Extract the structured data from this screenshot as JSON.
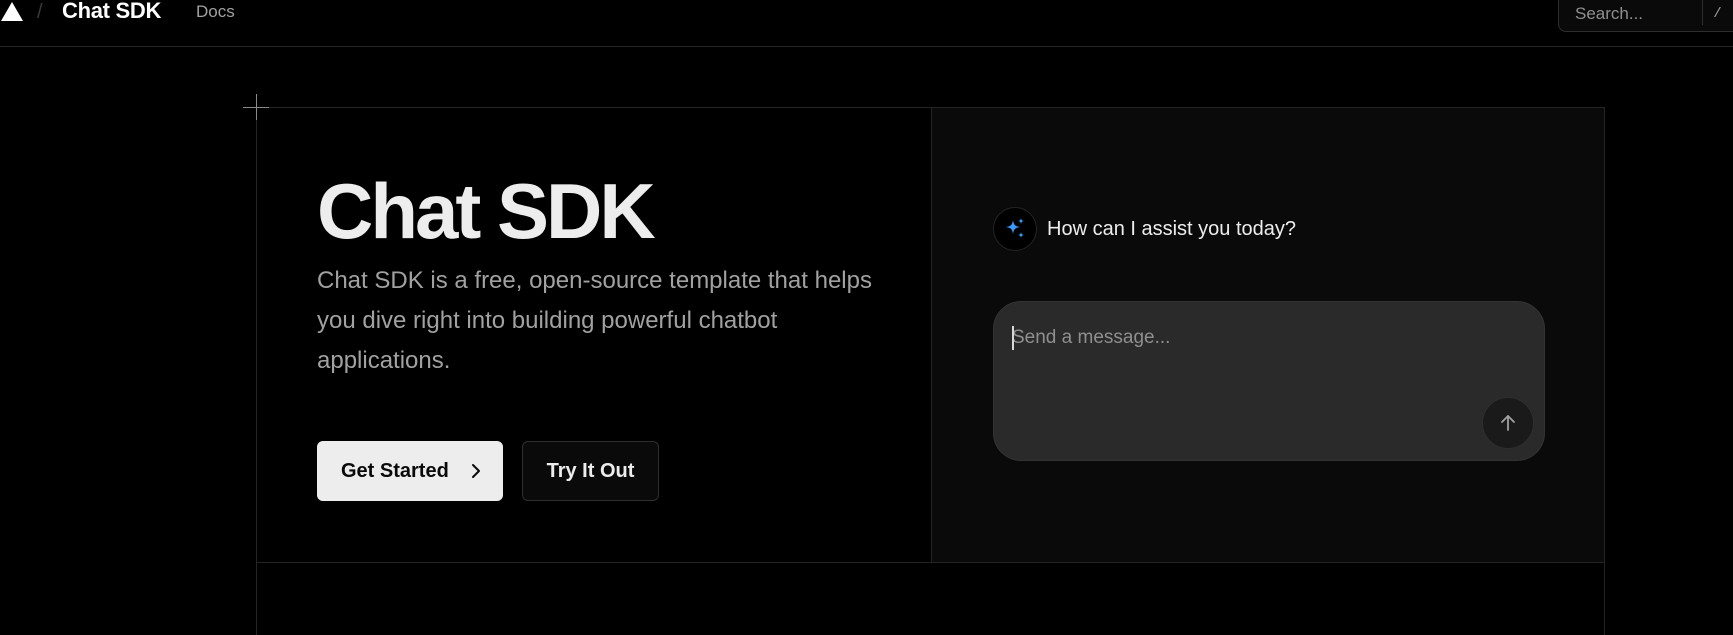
{
  "nav": {
    "brand": "Chat SDK",
    "separator": "/",
    "docs_link": "Docs",
    "search_placeholder": "Search...",
    "search_shortcut": "/"
  },
  "hero": {
    "title": "Chat SDK",
    "description": "Chat SDK is a free, open-source template that helps you dive right into building powerful chatbot applications.",
    "primary_button": "Get Started",
    "secondary_button": "Try It Out"
  },
  "chat_preview": {
    "assistant_message": "How can I assist you today?",
    "input_placeholder": "Send a message...",
    "input_value": ""
  },
  "icons": {
    "logo": "triangle-logo-icon",
    "chevron": "chevron-right-icon",
    "assistant": "sparkles-icon",
    "send": "arrow-up-icon"
  },
  "colors": {
    "background": "#000000",
    "panel": "#0a0a0a",
    "composer": "#2a2a2a",
    "accent_sparkle": "#3b9cff",
    "primary_button_bg": "#ededed"
  }
}
